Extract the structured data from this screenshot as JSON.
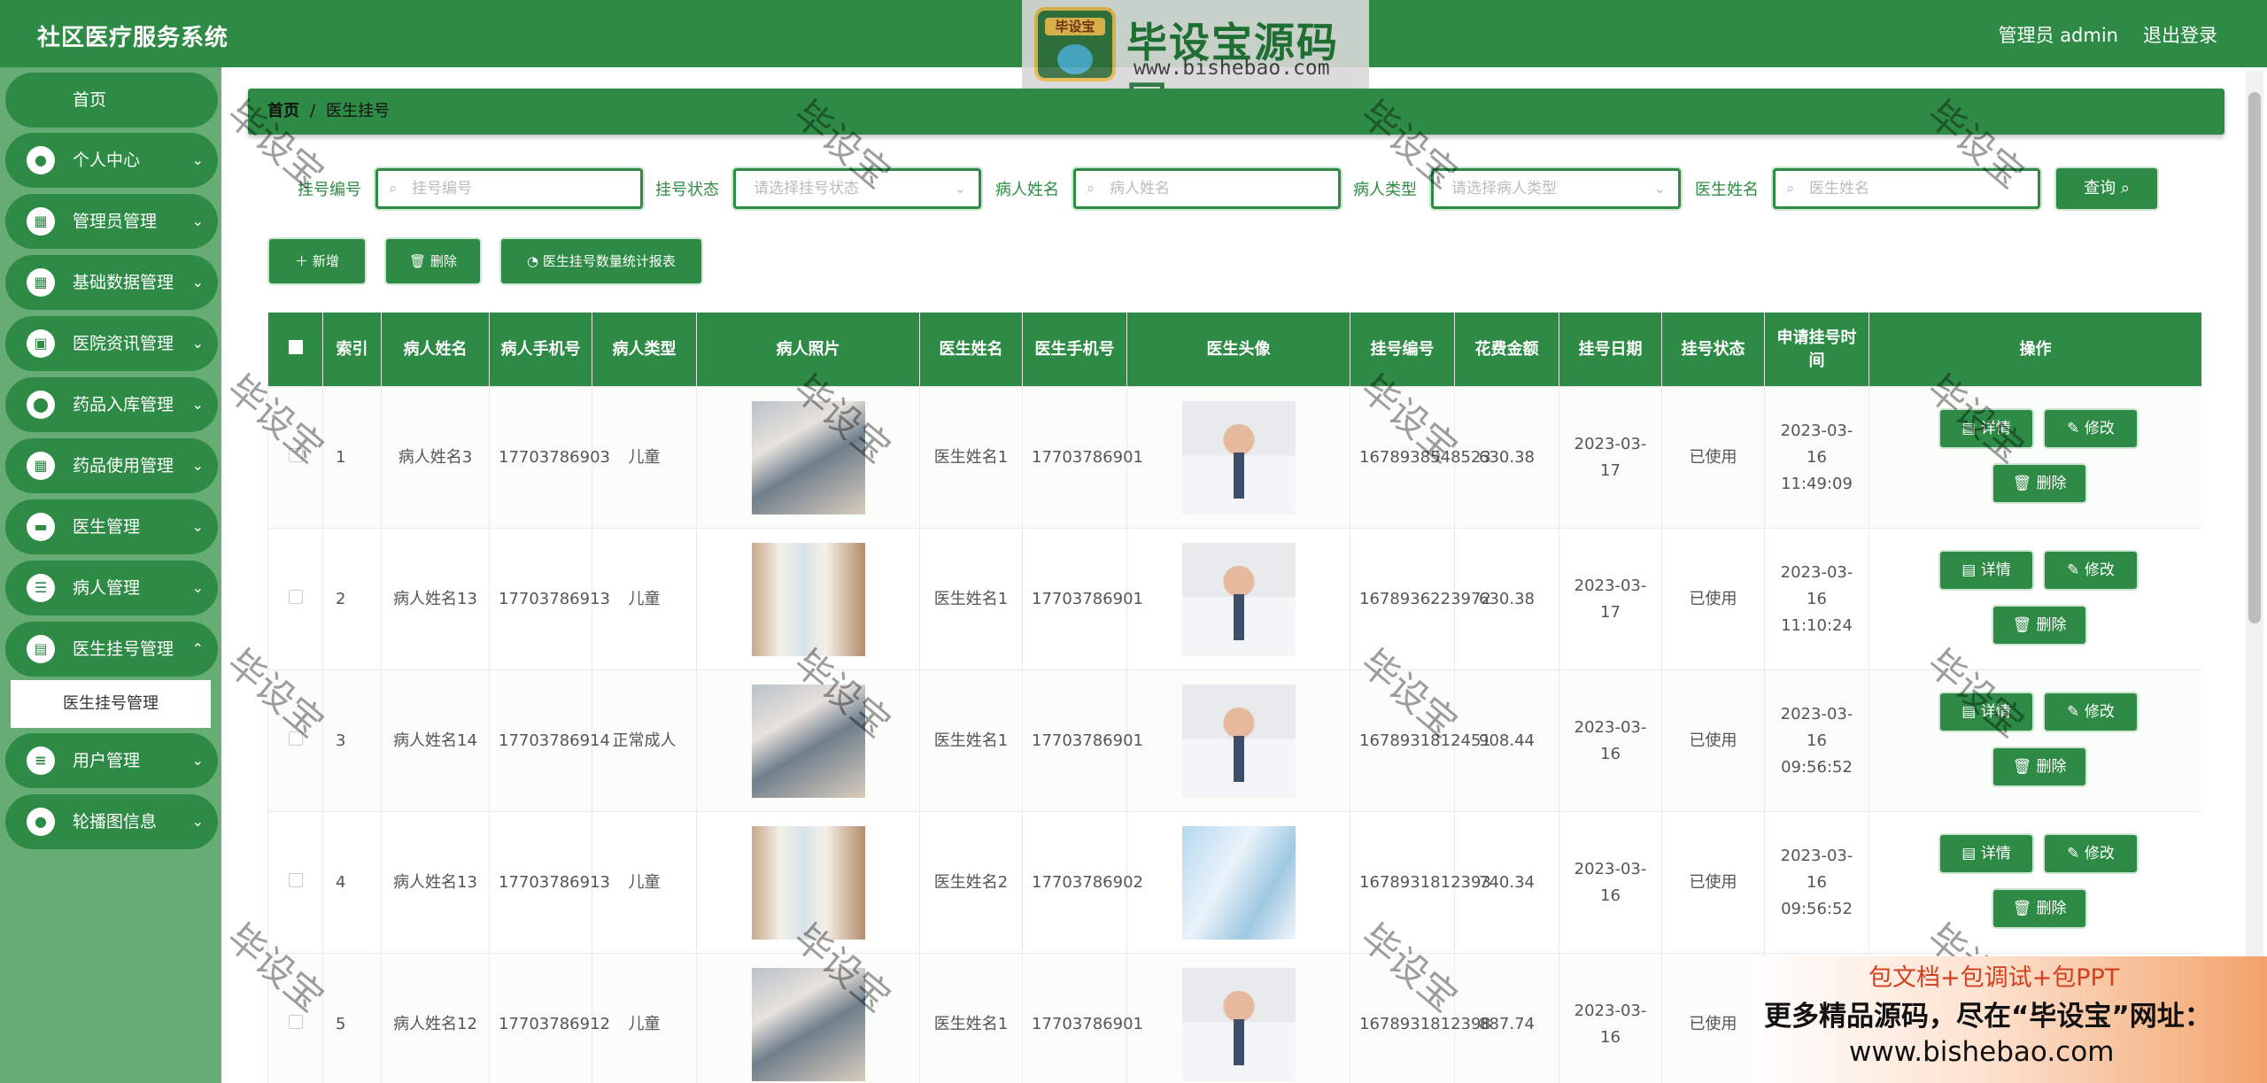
{
  "app": {
    "title": "社区医疗服务系统",
    "user": "管理员 admin",
    "logout": "退出登录"
  },
  "watermark": {
    "brand": "毕设宝源码网",
    "url": "www.bishebao.com",
    "badge": "毕设宝",
    "stamp": "毕设宝"
  },
  "sidebar": {
    "home": "首页",
    "items": [
      {
        "label": "个人中心",
        "icon": "person-icon"
      },
      {
        "label": "管理员管理",
        "icon": "grid-icon"
      },
      {
        "label": "基础数据管理",
        "icon": "grid-icon"
      },
      {
        "label": "医院资讯管理",
        "icon": "wallet-icon"
      },
      {
        "label": "药品入库管理",
        "icon": "location-pin-icon"
      },
      {
        "label": "药品使用管理",
        "icon": "grid-icon"
      },
      {
        "label": "医生管理",
        "icon": "briefcase-icon"
      },
      {
        "label": "病人管理",
        "icon": "sliders-icon"
      },
      {
        "label": "医生挂号管理",
        "icon": "document-icon"
      },
      {
        "label": "用户管理",
        "icon": "list-icon"
      },
      {
        "label": "轮播图信息",
        "icon": "person-icon"
      }
    ],
    "sub_active": "医生挂号管理"
  },
  "breadcrumb": {
    "home": "首页",
    "separator": "/",
    "current": "医生挂号"
  },
  "search": {
    "fields": [
      {
        "label": "挂号编号",
        "placeholder": "挂号编号",
        "type": "input"
      },
      {
        "label": "挂号状态",
        "placeholder": "请选择挂号状态",
        "type": "select"
      },
      {
        "label": "病人姓名",
        "placeholder": "病人姓名",
        "type": "input"
      },
      {
        "label": "病人类型",
        "placeholder": "请选择病人类型",
        "type": "select"
      },
      {
        "label": "医生姓名",
        "placeholder": "医生姓名",
        "type": "input"
      }
    ],
    "query_label": "查询"
  },
  "actions": {
    "add": "新增",
    "delete": "删除",
    "report": "医生挂号数量统计报表"
  },
  "table": {
    "headers": [
      "索引",
      "病人姓名",
      "病人手机号",
      "病人类型",
      "病人照片",
      "医生姓名",
      "医生手机号",
      "医生头像",
      "挂号编号",
      "花费金额",
      "挂号日期",
      "挂号状态",
      "申请挂号时间",
      "操作"
    ],
    "rows": [
      {
        "index": "1",
        "patient": "病人姓名3",
        "phone": "17703786903",
        "ptype": "儿童",
        "doctor": "医生姓名1",
        "dphone": "17703786901",
        "code": "1678938548523",
        "fee": "630.38",
        "date": "2023-03-17",
        "status": "已使用",
        "applied": "2023-03-16 11:49:09"
      },
      {
        "index": "2",
        "patient": "病人姓名13",
        "phone": "17703786913",
        "ptype": "儿童",
        "doctor": "医生姓名1",
        "dphone": "17703786901",
        "code": "1678936223972",
        "fee": "630.38",
        "date": "2023-03-17",
        "status": "已使用",
        "applied": "2023-03-16 11:10:24"
      },
      {
        "index": "3",
        "patient": "病人姓名14",
        "phone": "17703786914",
        "ptype": "正常成人",
        "doctor": "医生姓名1",
        "dphone": "17703786901",
        "code": "1678931812451",
        "fee": "908.44",
        "date": "2023-03-16",
        "status": "已使用",
        "applied": "2023-03-16 09:56:52"
      },
      {
        "index": "4",
        "patient": "病人姓名13",
        "phone": "17703786913",
        "ptype": "儿童",
        "doctor": "医生姓名2",
        "dphone": "17703786902",
        "code": "1678931812393",
        "fee": "740.34",
        "date": "2023-03-16",
        "status": "已使用",
        "applied": "2023-03-16 09:56:52"
      },
      {
        "index": "5",
        "patient": "病人姓名12",
        "phone": "17703786912",
        "ptype": "儿童",
        "doctor": "医生姓名1",
        "dphone": "17703786901",
        "code": "1678931812398",
        "fee": "887.74",
        "date": "2023-03-16",
        "status": "已使用",
        "applied": ""
      }
    ],
    "row_actions": {
      "detail": "详情",
      "edit": "修改",
      "delete": "删除"
    }
  },
  "ad": {
    "line1": "包文档+包调试+包PPT",
    "line2": "更多精品源码，尽在“毕设宝”网址：",
    "line3": "www.bishebao.com"
  },
  "colors": {
    "primary": "#2e8b45",
    "sidebar": "#67ac74"
  }
}
